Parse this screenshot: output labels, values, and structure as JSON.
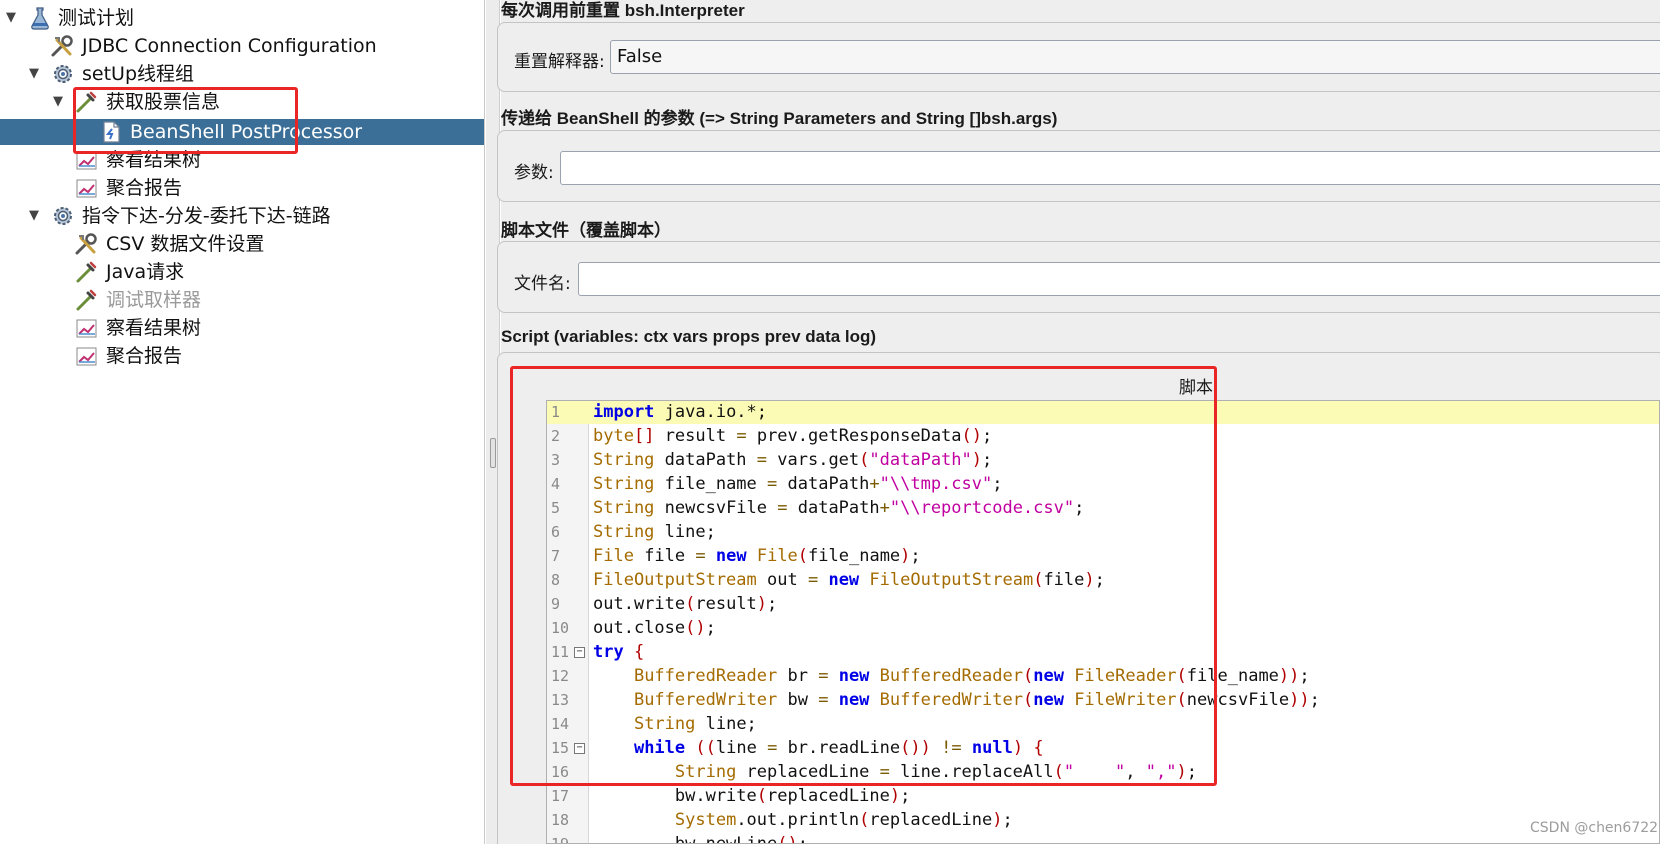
{
  "tree": {
    "items": [
      {
        "label": "测试计划",
        "icon": "flask-icon",
        "toggle": "▼"
      },
      {
        "label": "JDBC Connection Configuration",
        "icon": "wrench-icon"
      },
      {
        "label": "setUp线程组",
        "icon": "gear-icon",
        "toggle": "▼"
      },
      {
        "label": "获取股票信息",
        "icon": "pipette-icon",
        "toggle": "▼"
      },
      {
        "label": "BeanShell PostProcessor",
        "icon": "document-icon",
        "selected": true
      },
      {
        "label": "察看结果树",
        "icon": "graph-icon"
      },
      {
        "label": "聚合报告",
        "icon": "graph-icon"
      },
      {
        "label": "指令下达-分发-委托下达-链路",
        "icon": "gear-icon",
        "toggle": "▼"
      },
      {
        "label": "CSV 数据文件设置",
        "icon": "wrench-icon"
      },
      {
        "label": "Java请求",
        "icon": "pipette-icon"
      },
      {
        "label": "调试取样器",
        "icon": "pipette-icon",
        "disabled": true
      },
      {
        "label": "察看结果树",
        "icon": "graph-icon"
      },
      {
        "label": "聚合报告",
        "icon": "graph-icon"
      }
    ]
  },
  "panel": {
    "reset_section_title": "每次调用前重置 bsh.Interpreter",
    "reset_label": "重置解释器:",
    "reset_value": "False",
    "params_section_title": "传递给 BeanShell 的参数 (=> String Parameters and String []bsh.args)",
    "params_label": "参数:",
    "params_value": "",
    "file_section_title": "脚本文件（覆盖脚本）",
    "file_label": "文件名:",
    "file_value": "",
    "script_section_title": "Script (variables: ctx vars props prev data log)",
    "script_caption": "脚本"
  },
  "script": {
    "lines": [
      "import java.io.*;",
      "byte[] result = prev.getResponseData();",
      "String dataPath = vars.get(\"dataPath\");",
      "String file_name = dataPath+\"\\\\tmp.csv\";",
      "String newcsvFile = dataPath+\"\\\\reportcode.csv\";",
      "String line;",
      "File file = new File(file_name);",
      "FileOutputStream out = new FileOutputStream(file);",
      "out.write(result);",
      "out.close();",
      "try {",
      "    BufferedReader br = new BufferedReader(new FileReader(file_name));",
      "    BufferedWriter bw = new BufferedWriter(new FileWriter(newcsvFile));",
      "    String line;",
      "    while ((line = br.readLine()) != null) {",
      "        String replacedLine = line.replaceAll(\"    \", \",\");",
      "        bw.write(replacedLine);",
      "        System.out.println(replacedLine);",
      "        bw.newLine();"
    ],
    "fold_lines": [
      11,
      15
    ],
    "current_line": 1
  },
  "watermark": "CSDN @chen6722",
  "colors": {
    "selection": "#3c6f98",
    "annotation_red": "#ea2525",
    "keyword": "#0000e6",
    "type": "#a46b00",
    "string": "#c000a0",
    "current_line": "#fcfbb5"
  }
}
